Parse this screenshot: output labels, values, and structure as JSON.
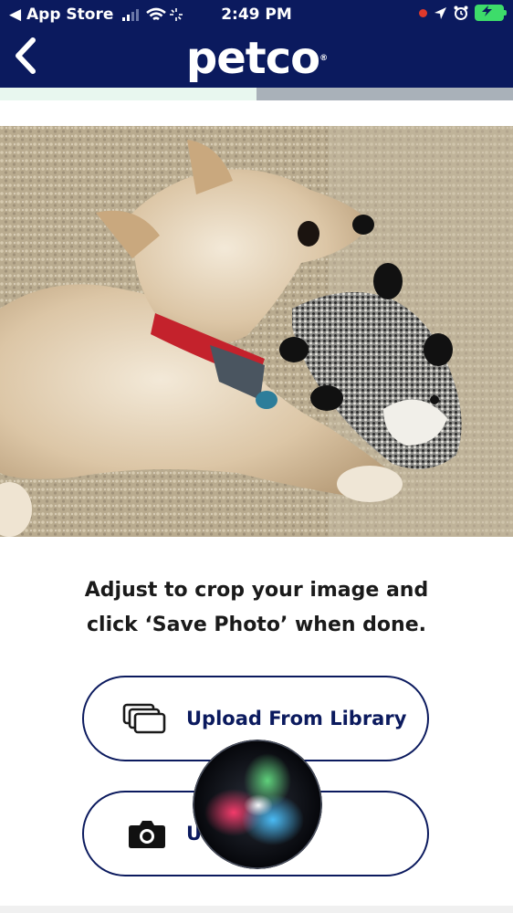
{
  "status_bar": {
    "back_app": "◀ App Store",
    "time": "2:49 PM"
  },
  "header": {
    "logo": "petco"
  },
  "progress": {
    "fraction": 0.5
  },
  "photo": {
    "subject": "dog-with-toy-photo"
  },
  "instructions": {
    "line1": "Adjust to crop your image and",
    "line2": "click ‘Save Photo’ when done."
  },
  "buttons": {
    "upload_label": "Upload From Library",
    "camera_label": "U"
  },
  "colors": {
    "brand": "#0b1a5e",
    "progress_fill": "#e8f7ef",
    "progress_track": "#a9b1b9"
  }
}
